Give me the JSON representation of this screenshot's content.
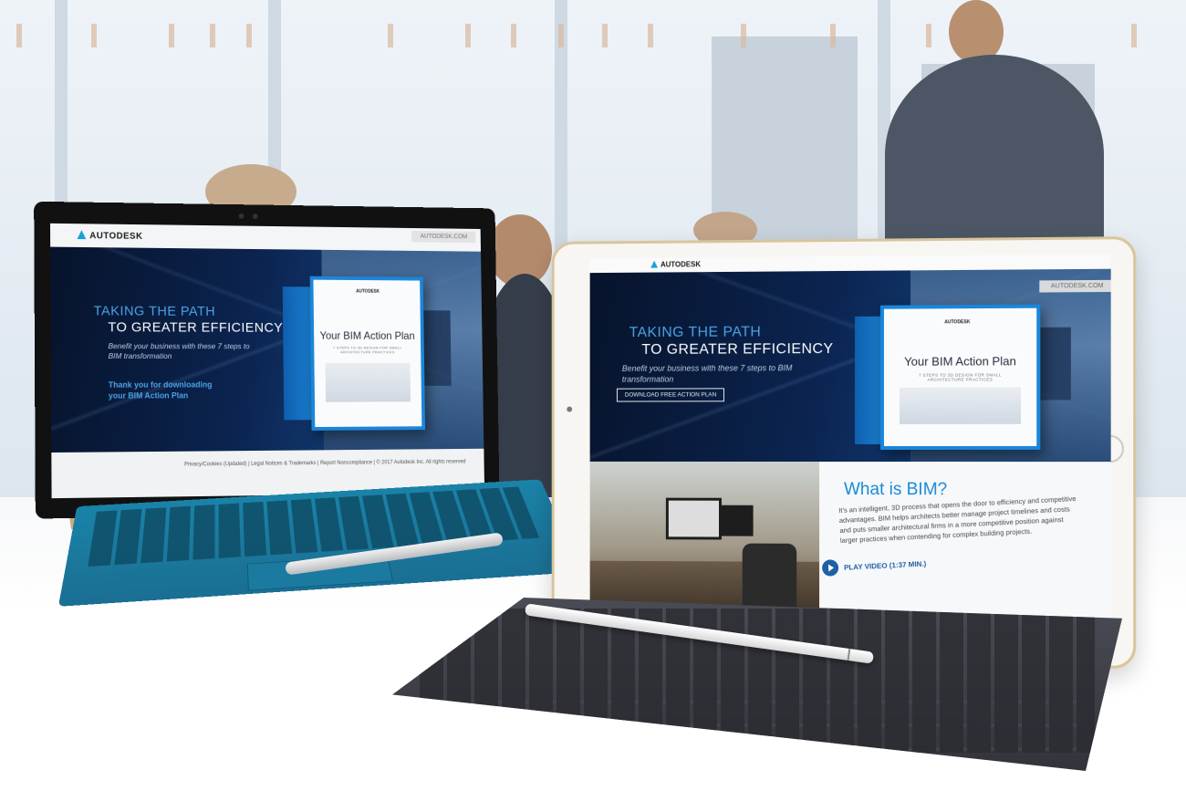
{
  "surface_page": {
    "header": {
      "logo": "AUTODESK",
      "url_tab": "AUTODESK.COM"
    },
    "hero": {
      "line1": "TAKING THE PATH",
      "line2": "TO GREATER EFFICIENCY",
      "lede": "Benefit your business with these 7 steps to BIM transformation",
      "thanks": "Thank you for downloading your BIM Action Plan"
    },
    "book": {
      "logo": "AUTODESK",
      "title": "Your BIM Action Plan",
      "subtitle": "7 STEPS TO 3D DESIGN FOR SMALL ARCHITECTURE PRACTICES"
    },
    "footer": {
      "links": "Privacy/Cookies (Updated) | Legal Notices & Trademarks | Report Noncompliance | © 2017 Autodesk Inc. All rights reserved"
    }
  },
  "ipad_page": {
    "header": {
      "logo": "AUTODESK",
      "url_tab": "AUTODESK.COM"
    },
    "hero": {
      "line1": "TAKING THE PATH",
      "line2": "TO GREATER EFFICIENCY",
      "lede": "Benefit your business with these 7 steps to BIM transformation",
      "download_button": "DOWNLOAD FREE ACTION PLAN"
    },
    "book": {
      "logo": "AUTODESK",
      "title": "Your BIM Action Plan",
      "subtitle": "7 STEPS TO 3D DESIGN FOR SMALL ARCHITECTURE PRACTICES"
    },
    "bim": {
      "title": "What is BIM?",
      "body": "It’s an intelligent, 3D process that opens the door to efficiency and competitive advantages. BIM helps architects better manage project timelines and costs and puts smaller architectural firms in a more competitive position against larger practices when contending for complex building projects.",
      "play_label": "PLAY VIDEO (1:37 MIN.)"
    }
  },
  "colors": {
    "brand_blue": "#1a86da",
    "heading_blue": "#4aa3e6",
    "navy": "#07132b",
    "keyboard_teal": "#1a83a8"
  }
}
